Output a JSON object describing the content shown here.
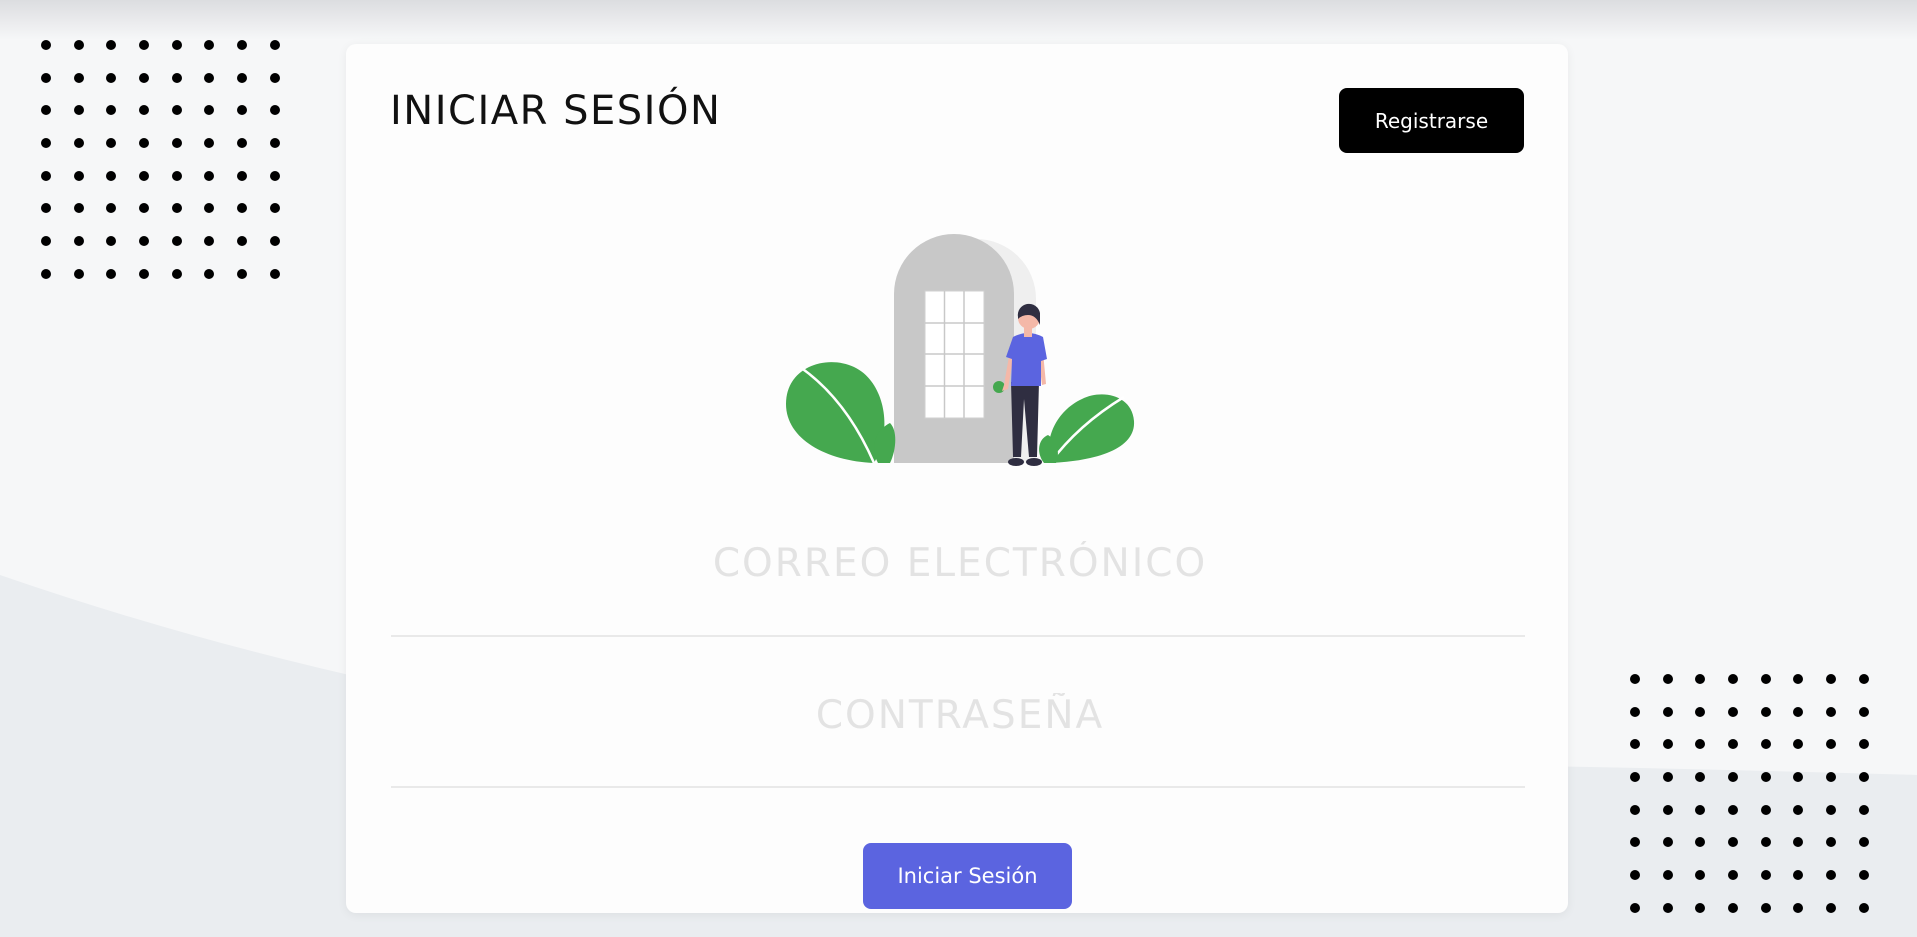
{
  "page": {
    "title": "INICIAR SESIÓN"
  },
  "header": {
    "register_label": "Registrarse"
  },
  "form": {
    "email_placeholder": "CORREO ELECTRÓNICO",
    "email_value": "",
    "password_placeholder": "CONTRASEÑA",
    "password_value": "",
    "submit_label": "Iniciar Sesión"
  },
  "icons": {
    "illustration": "person-at-door-illustration",
    "dots": "dot-grid-decoration"
  },
  "colors": {
    "primary": "#5b64e0",
    "register_button": "#000000",
    "leaf_green": "#45a84f",
    "door_gray": "#c8c8c8",
    "shirt_blue": "#5b64e0"
  }
}
